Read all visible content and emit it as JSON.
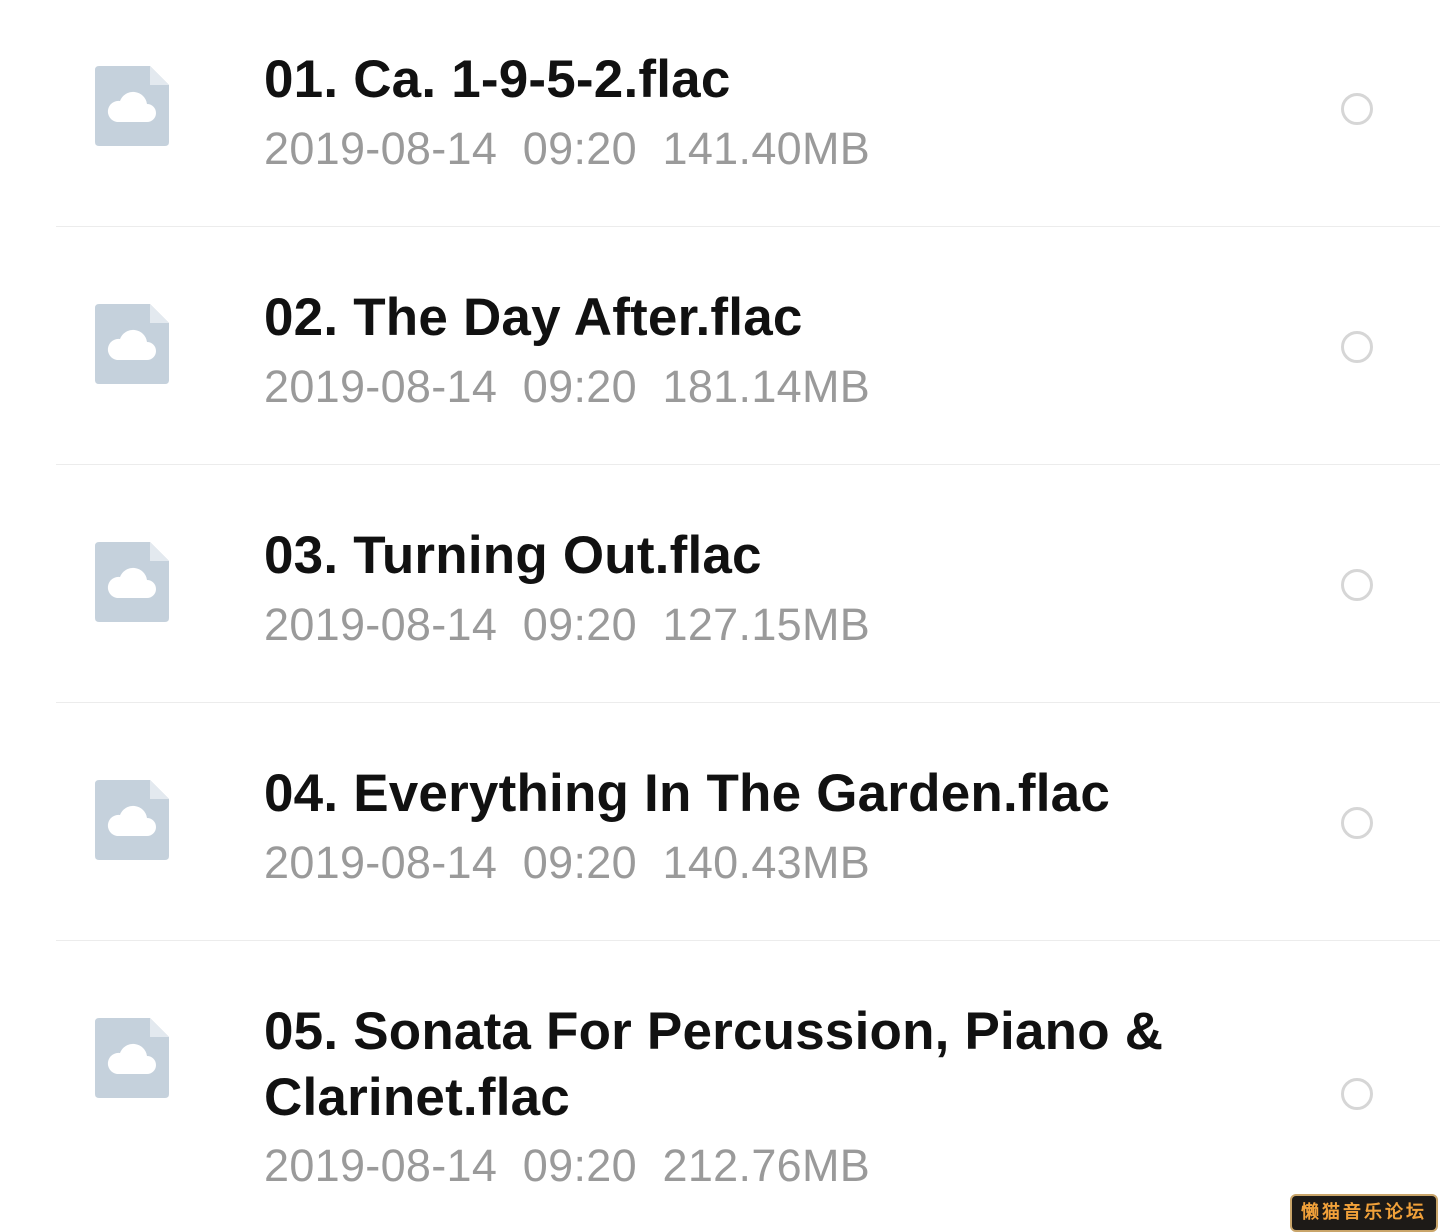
{
  "files": [
    {
      "name": "01. Ca. 1-9-5-2.flac",
      "date": "2019-08-14",
      "time": "09:20",
      "size": "141.40MB",
      "icon": "cloud-file-icon",
      "selected": false
    },
    {
      "name": "02. The Day After.flac",
      "date": "2019-08-14",
      "time": "09:20",
      "size": "181.14MB",
      "icon": "cloud-file-icon",
      "selected": false
    },
    {
      "name": "03. Turning Out.flac",
      "date": "2019-08-14",
      "time": "09:20",
      "size": "127.15MB",
      "icon": "cloud-file-icon",
      "selected": false
    },
    {
      "name": "04. Everything In The Garden.flac",
      "date": "2019-08-14",
      "time": "09:20",
      "size": "140.43MB",
      "icon": "cloud-file-icon",
      "selected": false
    },
    {
      "name": "05. Sonata For Percussion, Piano & Clarinet.flac",
      "date": "2019-08-14",
      "time": "09:20",
      "size": "212.76MB",
      "icon": "cloud-file-icon",
      "selected": false
    }
  ],
  "watermark": {
    "text": "懒猫音乐论坛"
  },
  "colors": {
    "icon": "#c5d1dc",
    "icon_fold": "#e3e9ef",
    "name_text": "#111111",
    "meta_text": "#9a9a9a",
    "divider": "#ececec",
    "radio_border": "#d6d6d6"
  }
}
